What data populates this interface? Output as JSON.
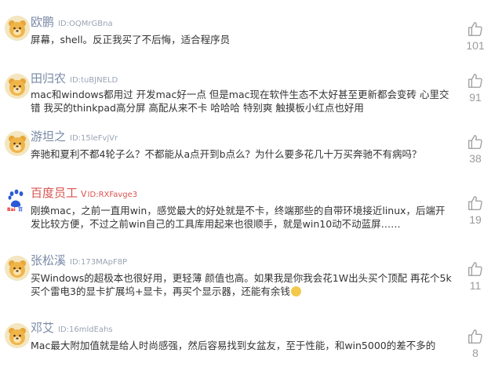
{
  "comments": [
    {
      "username": "欧鹏",
      "uid": "ID:OQMrGBna",
      "text": "屏幕，shell。反正我买了不后悔，适合程序员",
      "likes": "101"
    },
    {
      "username": "田归农",
      "uid": "ID:tuBJNELD",
      "text": "mac和windows都用过 开发mac好一点 但是mac现在软件生态不太好甚至更新都会变砖 心里交错 我买的thinkpad高分屏 高配从来不卡 哈哈哈 特别爽 触摸板小红点也好用",
      "likes": "91"
    },
    {
      "username": "游坦之",
      "uid": "ID:15leFvjVr",
      "text": "奔驰和夏利不都4轮子么？不都能从a点开到b点么？为什么要多花几十万买奔驰不有病吗？",
      "likes": "38"
    },
    {
      "username": "百度员工",
      "vip_icon": "V",
      "uid": "ID:RXFavge3",
      "text": "刚换mac，之前一直用win，感觉最大的好处就是不卡，终端那些的自带环境接近linux，后端开发比较方便，不过之前win自己的工具库用起来也很顺手，就是win10动不动蓝屏……",
      "likes": "19"
    },
    {
      "username": "张松溪",
      "uid": "ID:173MApF8P",
      "text": "买Windows的超极本也很好用，更轻薄 颜值也高。如果我是你我会花1W出头买个顶配 再花个5k买个雷电3的显卡扩展坞+显卡，再买个显示器，还能有余钱",
      "likes": "11"
    },
    {
      "username": "邓艾",
      "uid": "ID:16mldEahs",
      "text": "Mac最大附加值就是给人时尚感强，然后容易找到女盆友，至于性能，和win5000的差不多的",
      "likes": "8"
    }
  ],
  "icons": {
    "avatar": "bear-avatar-icon",
    "baidu_avatar": "baidu-logo-icon",
    "like": "thumbs-up-icon",
    "emoji": "smile-emoji-icon"
  },
  "colors": {
    "username": "#7a8aa6",
    "vip_username": "#d9534f",
    "uid": "#9aa4b4",
    "text": "#333333",
    "like": "#9b9b9b"
  }
}
